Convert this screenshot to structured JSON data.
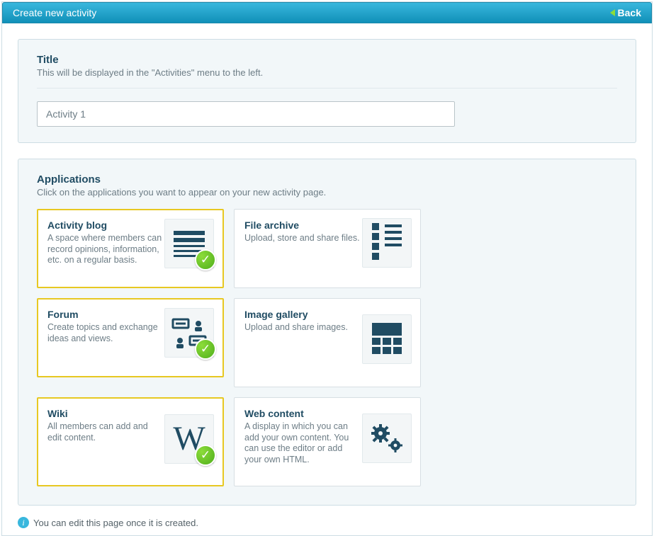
{
  "header": {
    "title": "Create new activity",
    "back_label": "Back"
  },
  "title_section": {
    "heading": "Title",
    "sub": "This will be displayed in the \"Activities\" menu to the left.",
    "input_value": "Activity 1"
  },
  "apps_section": {
    "heading": "Applications",
    "sub": "Click on the applications you want to appear on your new activity page.",
    "cards": [
      {
        "title": "Activity blog",
        "desc": "A space where members can record opinions, information, etc. on a regular basis.",
        "selected": true
      },
      {
        "title": "File archive",
        "desc": "Upload, store and share files.",
        "selected": false
      },
      {
        "title": "Forum",
        "desc": "Create topics and exchange ideas and views.",
        "selected": true
      },
      {
        "title": "Image gallery",
        "desc": "Upload and share images.",
        "selected": false
      },
      {
        "title": "Wiki",
        "desc": "All members can add and edit content.",
        "selected": true
      },
      {
        "title": "Web content",
        "desc": "A display in which you can add your own content. You can use the editor or add your own HTML.",
        "selected": false
      }
    ]
  },
  "footer_note": "You can edit this page once it is created."
}
